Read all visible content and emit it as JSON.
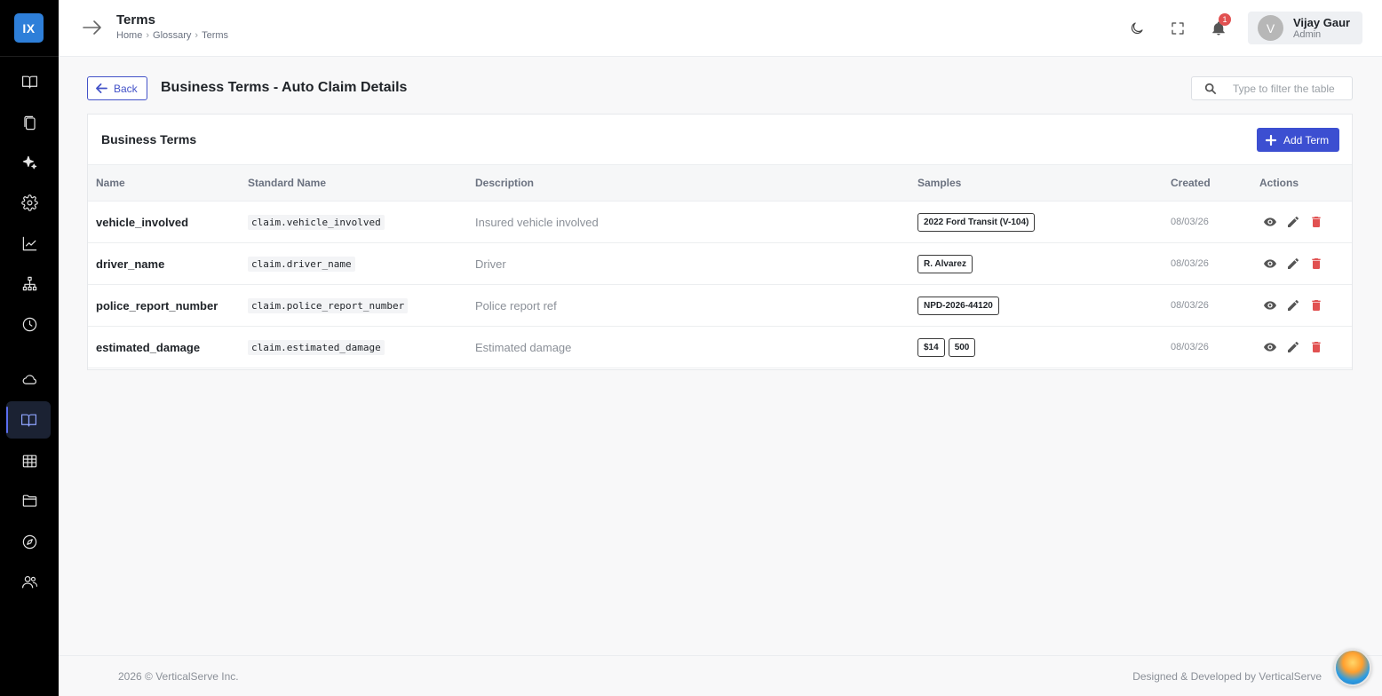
{
  "app": {
    "logo": "IX"
  },
  "header": {
    "title": "Terms",
    "breadcrumb": [
      "Home",
      "Glossary",
      "Terms"
    ],
    "notification_count": "1",
    "user": {
      "initial": "V",
      "name": "Vijay Gaur",
      "role": "Admin"
    }
  },
  "sidebar": {
    "items": [
      {
        "icon": "book-open-icon"
      },
      {
        "icon": "copy-icon"
      },
      {
        "icon": "sparkles-icon"
      },
      {
        "icon": "settings-icon"
      },
      {
        "icon": "line-chart-icon"
      },
      {
        "icon": "hierarchy-icon"
      },
      {
        "icon": "history-icon"
      },
      {
        "icon": "cloud-icon"
      },
      {
        "icon": "book-open-icon",
        "active": true
      },
      {
        "icon": "table-icon"
      },
      {
        "icon": "folder-icon"
      },
      {
        "icon": "compass-icon"
      },
      {
        "icon": "users-icon"
      }
    ],
    "active_color": "#5a6ef0"
  },
  "page": {
    "back_label": "Back",
    "title": "Business Terms - Auto Claim Details",
    "filter_placeholder": "Type to filter the table"
  },
  "card": {
    "title": "Business Terms",
    "add_label": "Add Term",
    "columns": [
      "Name",
      "Standard Name",
      "Description",
      "Samples",
      "Created",
      "Actions"
    ],
    "rows": [
      {
        "name": "vehicle_involved",
        "standard_name": "claim.vehicle_involved",
        "description": "Insured vehicle involved",
        "samples": [
          "2022 Ford Transit (V-104)"
        ],
        "created": "08/03/26"
      },
      {
        "name": "driver_name",
        "standard_name": "claim.driver_name",
        "description": "Driver",
        "samples": [
          "R. Alvarez"
        ],
        "created": "08/03/26"
      },
      {
        "name": "police_report_number",
        "standard_name": "claim.police_report_number",
        "description": "Police report ref",
        "samples": [
          "NPD-2026-44120"
        ],
        "created": "08/03/26"
      },
      {
        "name": "estimated_damage",
        "standard_name": "claim.estimated_damage",
        "description": "Estimated damage",
        "samples": [
          "$14",
          "500"
        ],
        "created": "08/03/26"
      }
    ]
  },
  "footer": {
    "left": "2026 © VerticalServe Inc.",
    "right": "Designed & Developed by VerticalServe"
  },
  "colors": {
    "primary": "#3c4fd1",
    "danger": "#e15151",
    "logo_bg": "#2e7fd9"
  }
}
